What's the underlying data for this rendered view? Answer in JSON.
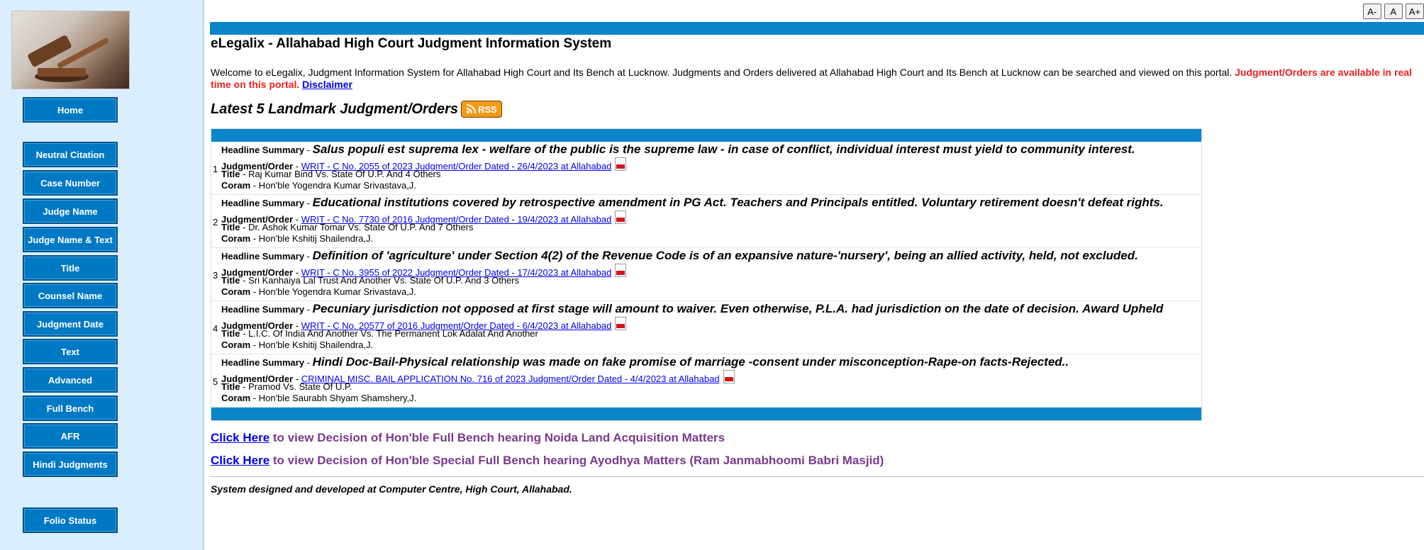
{
  "font_buttons": [
    "A-",
    "A",
    "A+"
  ],
  "nav": [
    {
      "label": "Home"
    },
    {
      "label": "Neutral Citation"
    },
    {
      "label": "Case Number"
    },
    {
      "label": "Judge Name"
    },
    {
      "label": "Judge Name & Text"
    },
    {
      "label": "Title"
    },
    {
      "label": "Counsel Name"
    },
    {
      "label": "Judgment Date"
    },
    {
      "label": "Text"
    },
    {
      "label": "Advanced"
    },
    {
      "label": "Full Bench"
    },
    {
      "label": "AFR"
    },
    {
      "label": "Hindi Judgments"
    },
    {
      "label": "Folio Status"
    }
  ],
  "header": {
    "title": "eLegalix - Allahabad High Court Judgment Information System",
    "welcome_text": "Welcome to eLegalix, Judgment Information System for Allahabad High Court and Its Bench at Lucknow. Judgments and Orders delivered at Allahabad High Court and Its Bench at Lucknow can be searched and viewed on this portal.",
    "welcome_highlight": "Judgment/Orders are available in real time on this portal.",
    "disclaimer": "Disclaimer"
  },
  "latest": {
    "heading": "Latest 5 Landmark Judgment/Orders",
    "rss_label": "RSS"
  },
  "labels": {
    "headline": "Headline Summary",
    "judgment": "Judgment/Order",
    "title": "Title",
    "coram": "Coram",
    "sep": " - "
  },
  "judgments": [
    {
      "num": "1",
      "headline": "Salus populi est suprema lex - welfare of the public is the supreme law - in case of conflict, individual interest must yield to community interest.",
      "link": "WRIT - C No. 2055 of 2023 Judgment/Order Dated - 26/4/2023 at Allahabad",
      "title": "Raj Kumar Bind Vs. State Of U.P. And 4 Others",
      "coram": "Hon'ble Yogendra Kumar Srivastava,J."
    },
    {
      "num": "2",
      "headline": "Educational institutions covered by retrospective amendment in PG Act. Teachers and Principals entitled. Voluntary retirement doesn't defeat rights.",
      "link": "WRIT - C No. 7730 of 2016 Judgment/Order Dated - 19/4/2023 at Allahabad",
      "title": "Dr. Ashok Kumar Tomar Vs. State Of U.P. And 7 Others",
      "coram": "Hon'ble Kshitij Shailendra,J."
    },
    {
      "num": "3",
      "headline": "Definition of 'agriculture' under Section 4(2) of the Revenue Code is of an expansive nature-'nursery', being an allied activity, held, not excluded.",
      "link": "WRIT - C No. 3955 of 2022 Judgment/Order Dated - 17/4/2023 at Allahabad",
      "title": "Sri Kanhaiya Lal Trust And Another Vs. State Of U.P. And 3 Others",
      "coram": "Hon'ble Yogendra Kumar Srivastava,J."
    },
    {
      "num": "4",
      "headline": "Pecuniary jurisdiction not opposed at first stage will amount to waiver. Even otherwise, P.L.A. had jurisdiction on the date of decision. Award Upheld",
      "link": "WRIT - C No. 20577 of 2016 Judgment/Order Dated - 6/4/2023 at Allahabad",
      "title": "L.I.C. Of India And Another Vs. The Permanent Lok Adalat And Another",
      "coram": "Hon'ble Kshitij Shailendra,J."
    },
    {
      "num": "5",
      "headline": "Hindi Doc-Bail-Physical relationship was made on fake promise of marriage -consent under misconception-Rape-on facts-Rejected..",
      "link": "CRIMINAL MISC. BAIL APPLICATION No. 716 of 2023 Judgment/Order Dated - 4/4/2023 at Allahabad",
      "title": "Pramod Vs. State Of U.P.",
      "coram": "Hon'ble Saurabh Shyam Shamshery,J."
    }
  ],
  "click_links": [
    {
      "link": "Click Here",
      "text": " to view Decision of Hon'ble Full Bench hearing Noida Land Acquisition Matters"
    },
    {
      "link": "Click Here",
      "text": " to view Decision of Hon'ble Special Full Bench hearing Ayodhya Matters (Ram Janmabhoomi Babri Masjid)"
    }
  ],
  "footer": "System designed and developed at Computer Centre, High Court, Allahabad.",
  "colors": {
    "accent": "#0a85c9",
    "nav_button": "#0079c4",
    "sidebar_bg": "#dbeeff",
    "highlight_red": "#e8211d",
    "click_text": "#7a3a8e"
  }
}
